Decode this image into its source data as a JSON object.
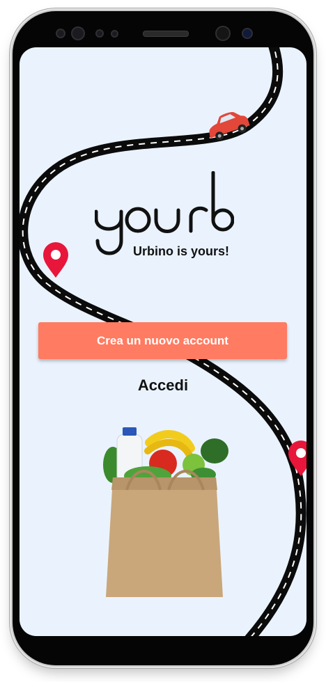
{
  "app": {
    "logo_text": "yourb",
    "tagline": "Urbino is yours!"
  },
  "actions": {
    "create_account_label": "Crea un nuovo account",
    "login_label": "Accedi"
  },
  "colors": {
    "background": "#eaf3fd",
    "primary_button": "#ff7b61",
    "pin": "#e8163a",
    "car": "#e2473a",
    "road": "#0b0b0b"
  },
  "icons": [
    "map-pin-icon",
    "car-icon",
    "grocery-bag-illustration",
    "road-illustration"
  ]
}
